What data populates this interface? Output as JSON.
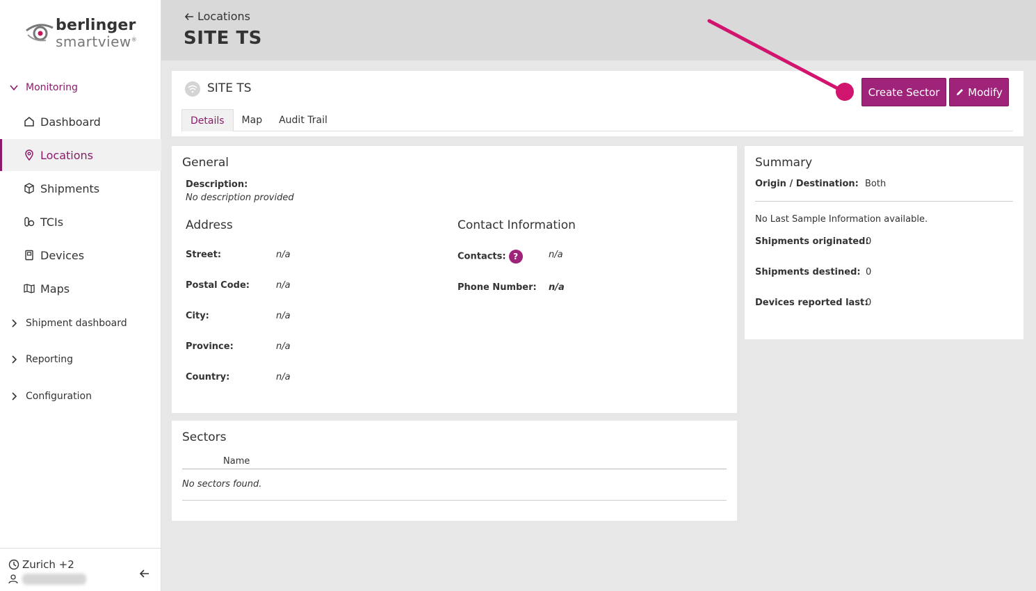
{
  "brand": {
    "top": "berlinger",
    "bottom": "smartview",
    "reg": "®"
  },
  "sidebar": {
    "groups": [
      {
        "label": "Monitoring",
        "open": true
      },
      {
        "label": "Shipment dashboard"
      },
      {
        "label": "Reporting"
      },
      {
        "label": "Configuration"
      }
    ],
    "items": [
      {
        "label": "Dashboard",
        "icon": "home-icon"
      },
      {
        "label": "Locations",
        "icon": "location-pin-icon",
        "active": true
      },
      {
        "label": "Shipments",
        "icon": "box-icon"
      },
      {
        "label": "TCIs",
        "icon": "tci-icon"
      },
      {
        "label": "Devices",
        "icon": "device-icon"
      },
      {
        "label": "Maps",
        "icon": "map-icon"
      }
    ],
    "footer": {
      "timezone": "Zurich +2"
    }
  },
  "header": {
    "back_label": "Locations",
    "title": "SITE TS"
  },
  "site": {
    "name": "SITE TS",
    "tabs": [
      "Details",
      "Map",
      "Audit Trail"
    ],
    "active_tab": "Details",
    "create_sector_label": "Create Sector",
    "modify_label": "Modify"
  },
  "general": {
    "title": "General",
    "description_label": "Description:",
    "description_value": "No description provided",
    "address": {
      "title": "Address",
      "fields": [
        {
          "label": "Street:",
          "value": "n/a"
        },
        {
          "label": "Postal Code:",
          "value": "n/a"
        },
        {
          "label": "City:",
          "value": "n/a"
        },
        {
          "label": "Province:",
          "value": "n/a"
        },
        {
          "label": "Country:",
          "value": "n/a"
        }
      ]
    },
    "contact": {
      "title": "Contact Information",
      "contacts_label": "Contacts:",
      "contacts_value": "n/a",
      "help": "?",
      "phone_label": "Phone Number:",
      "phone_value": "n/a"
    }
  },
  "summary": {
    "title": "Summary",
    "origin_label": "Origin / Destination:",
    "origin_value": "Both",
    "no_sample": "No Last Sample Information available.",
    "stats": [
      {
        "label": "Shipments originated:",
        "value": "0"
      },
      {
        "label": "Shipments destined:",
        "value": "0"
      },
      {
        "label": "Devices reported last:",
        "value": "0"
      }
    ]
  },
  "sectors": {
    "title": "Sectors",
    "column": "Name",
    "empty": "No sectors found."
  },
  "colors": {
    "accent": "#a0237a",
    "active_text": "#8b1a6b",
    "annotation": "#d1146e"
  }
}
